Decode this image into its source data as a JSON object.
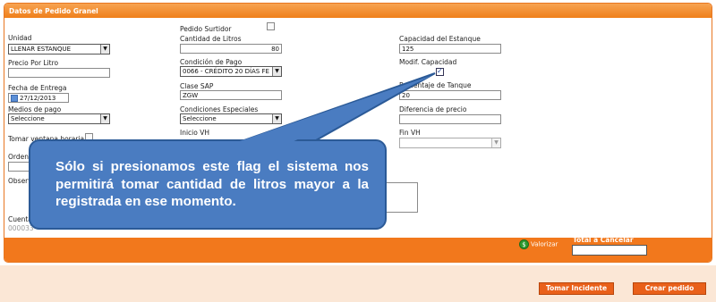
{
  "panel": {
    "title": "Datos de Pedido Granel"
  },
  "form": {
    "pedido_surtidor": {
      "label": "Pedido Surtidor",
      "checked": false
    },
    "unidad": {
      "label": "Unidad",
      "value": "LLENAR ESTANQUE"
    },
    "cantidad_litros": {
      "label": "Cantidad de Litros",
      "value": "80"
    },
    "capacidad_estanque": {
      "label": "Capacidad del Estanque",
      "value": "125"
    },
    "precio_por_litro": {
      "label": "Precio Por Litro",
      "value": ""
    },
    "condicion_pago": {
      "label": "Condición de Pago",
      "value": "0066 - CRÉDITO 20 DÍAS FE"
    },
    "modif_capacidad": {
      "label": "Modif. Capacidad",
      "checked": true
    },
    "fecha_entrega": {
      "label": "Fecha de Entrega",
      "value": "27/12/2013"
    },
    "clase_sap": {
      "label": "Clase SAP",
      "value": "ZGW"
    },
    "porcentaje_tanque": {
      "label": "Porcentaje de Tanque",
      "value": "20"
    },
    "medios_pago": {
      "label": "Medios de pago",
      "value": "Seleccione"
    },
    "condiciones_especiales": {
      "label": "Condiciones Especiales",
      "value": "Seleccione"
    },
    "diferencia_precio": {
      "label": "Diferencia de precio",
      "value": ""
    },
    "tomar_ventana": {
      "label": "Tomar ventana horaria",
      "checked": false
    },
    "inicio_vh": {
      "label": "Inicio VH"
    },
    "fin_vh": {
      "label": "Fin VH",
      "value": ""
    },
    "orden_label": "Orden",
    "observ_label": "Observ",
    "cuenta_label": "Cuenta",
    "cuenta_value": "000033"
  },
  "footer": {
    "valorizar": "Valorizar",
    "coin_symbol": "$",
    "total_label": "Total a Cancelar"
  },
  "actions": {
    "tomar_incidente": "Tomar Incidente",
    "crear_pedido": "Crear pedido"
  },
  "callout": {
    "text": "Sólo si presionamos este flag el sistema nos permitirá tomar cantidad de litros mayor a la registrada en ese momento."
  },
  "colors": {
    "accent_orange": "#ef7f1a",
    "callout_blue": "#4a7cc1"
  }
}
